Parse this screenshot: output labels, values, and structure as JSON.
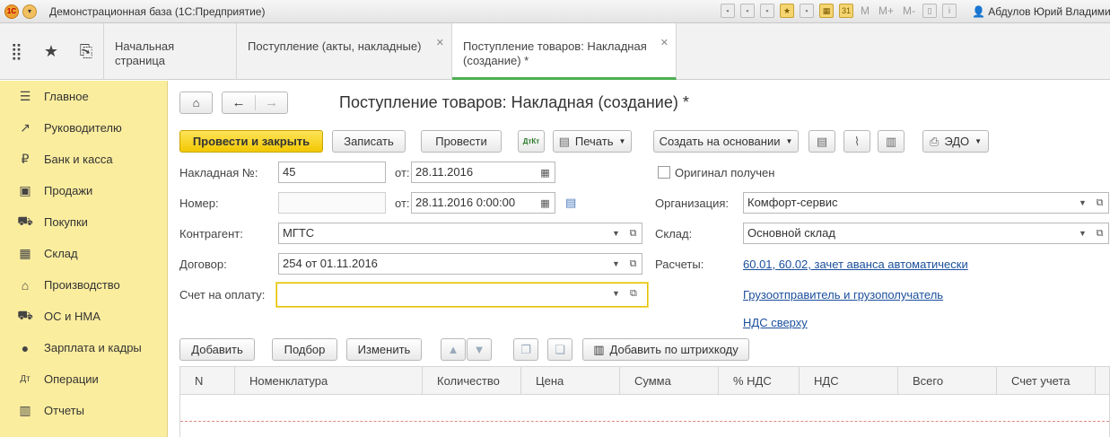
{
  "titlebar": {
    "app_title": "Демонстрационная база  (1С:Предприятие)",
    "m_buttons": [
      "M",
      "M+",
      "M-"
    ],
    "user": "Абдулов Юрий Владимирови"
  },
  "tabs": [
    {
      "label": "Начальная страница",
      "closable": false
    },
    {
      "label": "Поступление (акты, накладные)",
      "closable": true
    },
    {
      "label": "Поступление товаров: Накладная (создание) *",
      "closable": true,
      "active": true
    }
  ],
  "sidebar": {
    "items": [
      {
        "label": "Главное",
        "icon": "menu-lines-icon"
      },
      {
        "label": "Руководителю",
        "icon": "trend-icon"
      },
      {
        "label": "Банк и касса",
        "icon": "ruble-coin-icon"
      },
      {
        "label": "Продажи",
        "icon": "bag-icon"
      },
      {
        "label": "Покупки",
        "icon": "cart-icon"
      },
      {
        "label": "Склад",
        "icon": "warehouse-icon"
      },
      {
        "label": "Производство",
        "icon": "factory-icon"
      },
      {
        "label": "ОС и НМА",
        "icon": "truck-icon"
      },
      {
        "label": "Зарплата и кадры",
        "icon": "person-icon"
      },
      {
        "label": "Операции",
        "icon": "dt-kt-icon"
      },
      {
        "label": "Отчеты",
        "icon": "bar-chart-icon"
      }
    ]
  },
  "form": {
    "title": "Поступление товаров: Накладная (создание) *",
    "toolbar": {
      "post_close": "Провести и закрыть",
      "save": "Записать",
      "post": "Провести",
      "print": "Печать",
      "create_based": "Создать на основании",
      "edo": "ЭДО"
    },
    "fields": {
      "invoice_no_label": "Накладная №:",
      "invoice_no": "45",
      "from_label": "от:",
      "invoice_date": "28.11.2016",
      "number_label": "Номер:",
      "number": "",
      "from2_label": "от:",
      "number_date": "28.11.2016  0:00:00",
      "original_label": "Оригинал получен",
      "org_label": "Организация:",
      "org": "Комфорт-сервис",
      "counterparty_label": "Контрагент:",
      "counterparty": "МГТС",
      "warehouse_label": "Склад:",
      "warehouse": "Основной склад",
      "contract_label": "Договор:",
      "contract": "254 от 01.11.2016",
      "settlements_label": "Расчеты:",
      "settlements_link": "60.01, 60.02, зачет аванса автоматически",
      "invoice_pay_label": "Счет на оплату:",
      "invoice_pay": "",
      "shipper_link": "Грузоотправитель и грузополучатель",
      "vat_link": "НДС сверху"
    },
    "table_toolbar": {
      "add": "Добавить",
      "pick": "Подбор",
      "change": "Изменить",
      "add_barcode": "Добавить по штрихкоду"
    },
    "table_columns": [
      "N",
      "Номенклатура",
      "Количество",
      "Цена",
      "Сумма",
      "% НДС",
      "НДС",
      "Всего",
      "Счет учета"
    ]
  }
}
